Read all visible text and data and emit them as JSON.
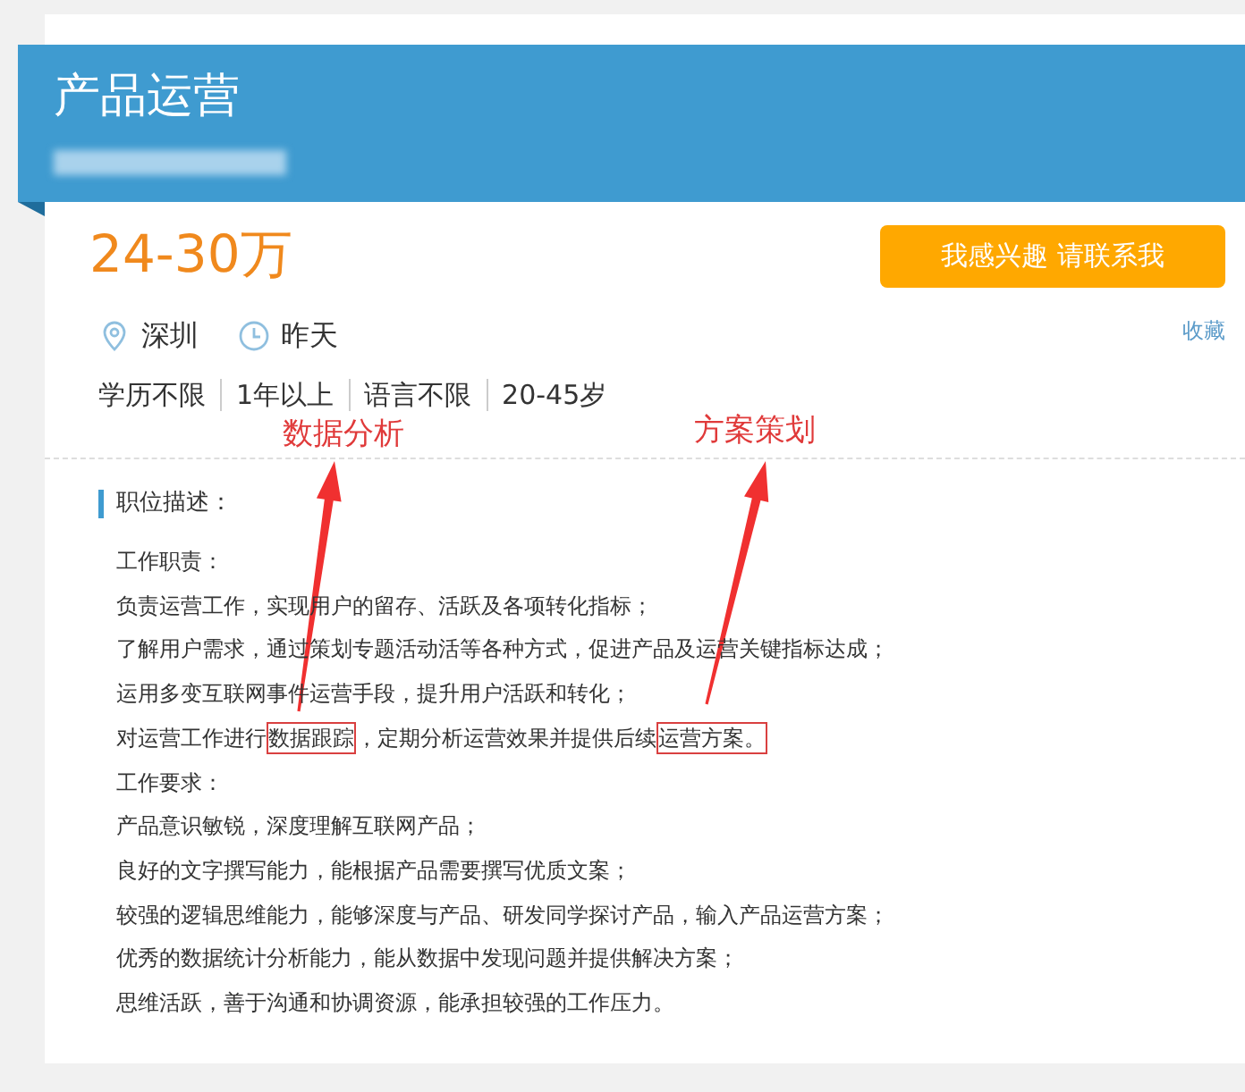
{
  "header": {
    "title": "产品运营",
    "company_blurred": true
  },
  "salary": "24-30万",
  "apply_button": "我感兴趣 请联系我",
  "favorite_link": "收藏",
  "meta": [
    {
      "kind": "location",
      "text": "深圳"
    },
    {
      "kind": "time",
      "text": "昨天"
    }
  ],
  "requirements": [
    "学历不限",
    "1年以上",
    "语言不限",
    "20-45岁"
  ],
  "annotations": [
    {
      "label": "数据分析"
    },
    {
      "label": "方案策划"
    }
  ],
  "description": {
    "heading": "职位描述：",
    "lines": [
      [
        {
          "text": "工作职责：",
          "highlighted": false
        }
      ],
      [
        {
          "text": "负责运营工作，实现用户的留存、活跃及各项转化指标；",
          "highlighted": false
        }
      ],
      [
        {
          "text": "了解用户需求，通过策划专题活动活等各种方式，促进产品及运营关键指标达成；",
          "highlighted": false
        }
      ],
      [
        {
          "text": "运用多变互联网事件运营手段，提升用户活跃和转化；",
          "highlighted": false
        }
      ],
      [
        {
          "text": "对运营工作进行",
          "highlighted": false
        },
        {
          "text": "数据跟踪",
          "highlighted": true
        },
        {
          "text": "，定期分析运营效果并提供后续",
          "highlighted": false
        },
        {
          "text": "运营方案。",
          "highlighted": true
        }
      ],
      [
        {
          "text": "工作要求：",
          "highlighted": false
        }
      ],
      [
        {
          "text": "产品意识敏锐，深度理解互联网产品；",
          "highlighted": false
        }
      ],
      [
        {
          "text": "良好的文字撰写能力，能根据产品需要撰写优质文案；",
          "highlighted": false
        }
      ],
      [
        {
          "text": "较强的逻辑思维能力，能够深度与产品、研发同学探讨产品，输入产品运营方案；",
          "highlighted": false
        }
      ],
      [
        {
          "text": "优秀的数据统计分析能力，能从数据中发现问题并提供解决方案；",
          "highlighted": false
        }
      ],
      [
        {
          "text": "思维活跃，善于沟通和协调资源，能承担较强的工作压力。",
          "highlighted": false
        }
      ]
    ]
  }
}
